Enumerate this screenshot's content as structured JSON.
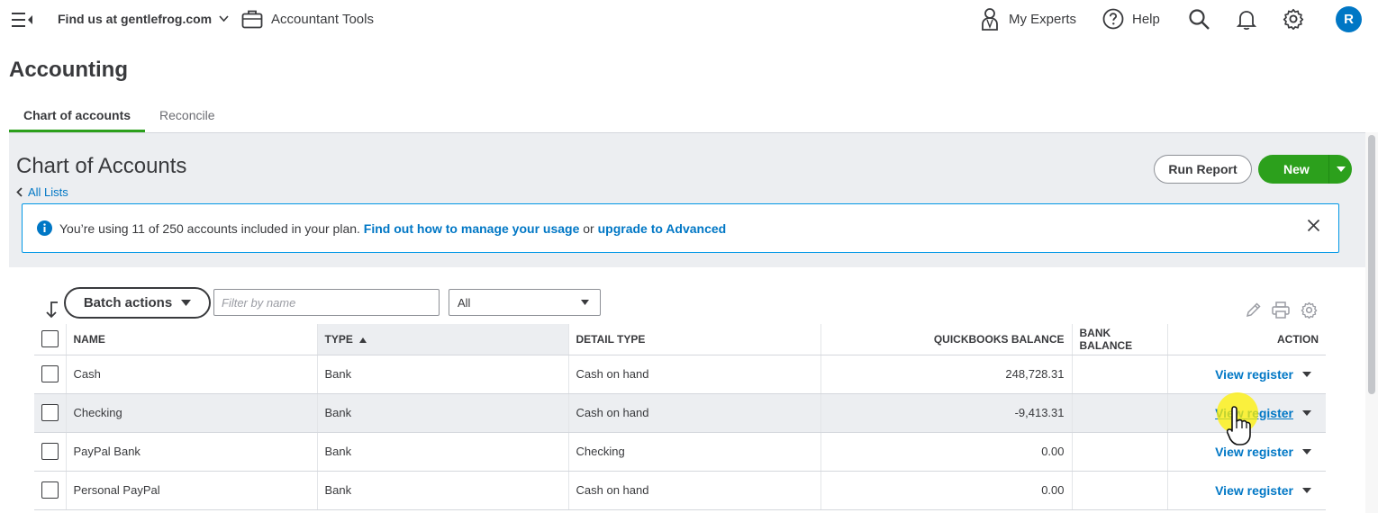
{
  "topbar": {
    "company": "Find us at gentlefrog.com",
    "accountant_tools": "Accountant Tools",
    "my_experts": "My Experts",
    "help": "Help",
    "avatar_initial": "R"
  },
  "page_title": "Accounting",
  "tabs": [
    {
      "label": "Chart of accounts",
      "active": true
    },
    {
      "label": "Reconcile",
      "active": false
    }
  ],
  "coa": {
    "title": "Chart of Accounts",
    "all_lists": "All Lists",
    "run_report": "Run Report",
    "new": "New"
  },
  "banner": {
    "text": "You’re using 11 of 250 accounts included in your plan.",
    "link1": "Find out how to manage your usage",
    "or": "or",
    "link2": "upgrade to Advanced"
  },
  "toolbar": {
    "batch_actions": "Batch actions",
    "filter_placeholder": "Filter by name",
    "type_filter": "All"
  },
  "table": {
    "headers": {
      "name": "NAME",
      "type": "TYPE",
      "detail_type": "DETAIL TYPE",
      "qb_balance": "QUICKBOOKS BALANCE",
      "bank_balance": "BANK BALANCE",
      "action": "ACTION"
    },
    "rows": [
      {
        "name": "Cash",
        "type": "Bank",
        "detail_type": "Cash on hand",
        "qb_balance": "248,728.31",
        "bank_balance": "",
        "action": "View register"
      },
      {
        "name": "Checking",
        "type": "Bank",
        "detail_type": "Cash on hand",
        "qb_balance": "-9,413.31",
        "bank_balance": "",
        "action": "View register"
      },
      {
        "name": "PayPal Bank",
        "type": "Bank",
        "detail_type": "Checking",
        "qb_balance": "0.00",
        "bank_balance": "",
        "action": "View register"
      },
      {
        "name": "Personal PayPal",
        "type": "Bank",
        "detail_type": "Cash on hand",
        "qb_balance": "0.00",
        "bank_balance": "",
        "action": "View register"
      }
    ]
  },
  "colors": {
    "accent_green": "#2ca01c",
    "link_blue": "#0077c5",
    "avatar_blue": "#0077c5"
  }
}
